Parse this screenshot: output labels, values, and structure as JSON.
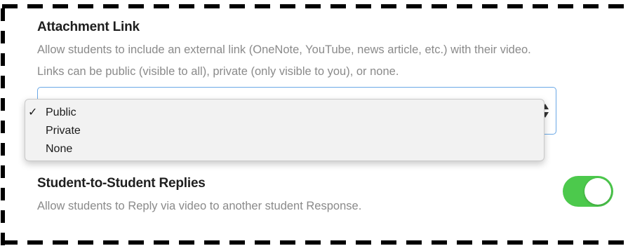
{
  "attachment_link": {
    "title": "Attachment Link",
    "description_line1": "Allow students to include an external link (OneNote, YouTube, news article, etc.) with their video.",
    "description_line2": "Links can be public (visible to all), private (only visible to you), or none.",
    "select": {
      "selected": "Public",
      "options": [
        {
          "label": "Public",
          "checked": true,
          "check_mark": "✓"
        },
        {
          "label": "Private",
          "checked": false,
          "check_mark": ""
        },
        {
          "label": "None",
          "checked": false,
          "check_mark": ""
        }
      ]
    }
  },
  "student_replies": {
    "title": "Student-to-Student Replies",
    "description": "Allow students to Reply via video to another student Response.",
    "toggle_on": true
  },
  "colors": {
    "select_border": "#6aa8e6",
    "toggle_on": "#4cc94c",
    "dropdown_bg": "#f2f2f2",
    "frame_dash": "#000000"
  },
  "icons": {
    "checkmark": "checkmark-icon",
    "select_arrows": "updown-arrows-icon"
  }
}
